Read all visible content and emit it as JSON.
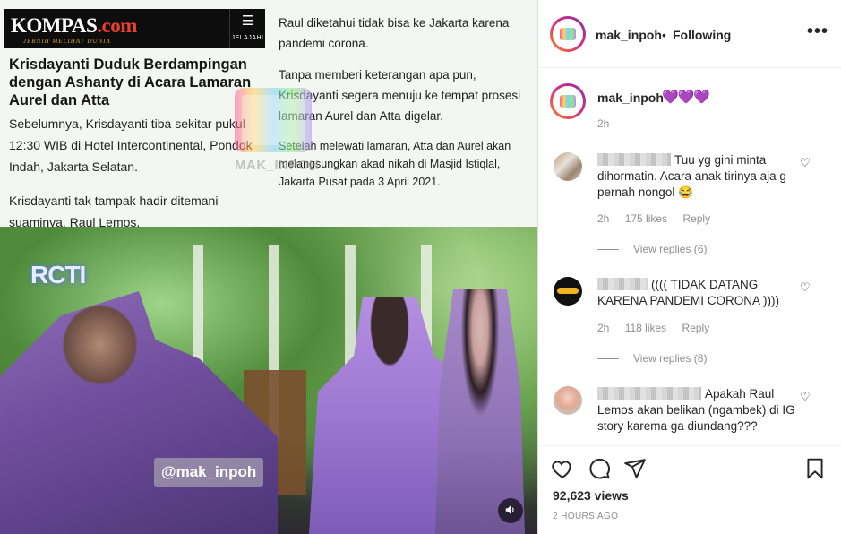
{
  "article": {
    "brand": "KOMPAS",
    "brand_suffix": ".com",
    "tagline": "JERNIH MELIHAT DUNIA",
    "explore_label": "JELAJAHI",
    "headline": "Krisdayanti Duduk Berdampingan dengan Ashanty di Acara Lamaran Aurel dan Atta",
    "left_paragraphs": [
      "Sebelumnya, Krisdayanti tiba sekitar pukul 12:30 WIB di Hotel Intercontinental, Pondok Indah, Jakarta Selatan.",
      "Krisdayanti tak tampak hadir ditemani suaminya, Raul Lemos."
    ],
    "right_paragraphs": [
      "Raul diketahui tidak bisa ke Jakarta karena pandemi corona.",
      "Tanpa memberi keterangan apa pun, Krisdayanti segera menuju ke tempat prosesi lamaran Aurel dan Atta digelar.",
      "Setelah melewati lamaran, Atta dan Aurel akan melangsungkan akad nikah di Masjid Istiqlal, Jakarta Pusat pada 3 April 2021."
    ],
    "watermark": "MAK_INPOH"
  },
  "video": {
    "channel_logo": "RCTI",
    "handle_overlay": "@mak_inpoh",
    "volume_icon": "speaker-icon"
  },
  "header": {
    "username": "mak_inpoh",
    "separator": "•",
    "follow_status": "Following",
    "more_icon": "more-horizontal-icon"
  },
  "caption": {
    "username": "mak_inpoh",
    "emoji": "💜💜💜",
    "time": "2h"
  },
  "comments": [
    {
      "text": "Tuu yg gini minta dihormatin. Acara anak tirinya aja g pernah nongol 😂",
      "time": "2h",
      "likes": "175 likes",
      "reply": "Reply",
      "view_replies": "View replies (6)"
    },
    {
      "text": "(((( TIDAK DATANG KARENA PANDEMI CORONA ))))",
      "time": "2h",
      "likes": "118 likes",
      "reply": "Reply",
      "view_replies": "View replies (8)"
    },
    {
      "text": "Apakah Raul Lemos akan belikan (ngambek) di IG story karema ga diundang???"
    }
  ],
  "footer": {
    "views": "92,623 views",
    "posted": "2 HOURS AGO"
  },
  "colors": {
    "hearts": "#a774f0",
    "story_ring_start": "#f58529",
    "story_ring_end": "#8134af",
    "muted_text": "#8e8e8e"
  }
}
